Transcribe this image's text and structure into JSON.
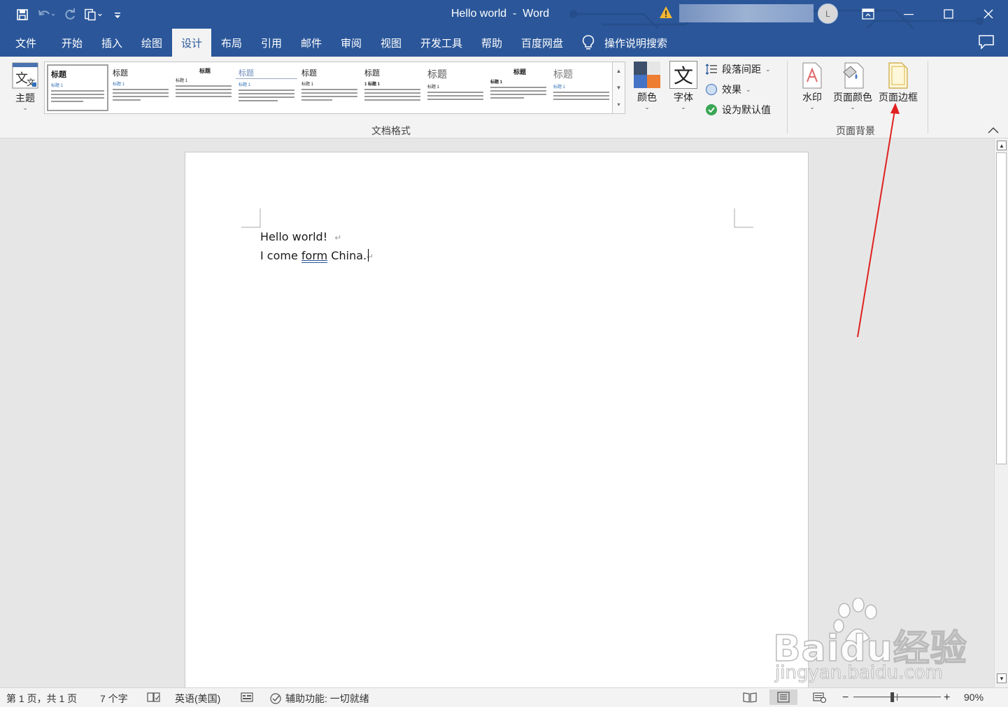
{
  "window": {
    "title": "Hello world  -  Word",
    "account_initial": "L"
  },
  "quick_access": {
    "save_icon": "save-icon",
    "undo_icon": "undo-icon",
    "redo_icon": "redo-icon",
    "format_painter_icon": "paste-icon",
    "customize_icon": "customize-icon"
  },
  "tabs": [
    {
      "label": "文件",
      "active": false
    },
    {
      "label": "开始",
      "active": false
    },
    {
      "label": "插入",
      "active": false
    },
    {
      "label": "绘图",
      "active": false
    },
    {
      "label": "设计",
      "active": true
    },
    {
      "label": "布局",
      "active": false
    },
    {
      "label": "引用",
      "active": false
    },
    {
      "label": "邮件",
      "active": false
    },
    {
      "label": "审阅",
      "active": false
    },
    {
      "label": "视图",
      "active": false
    },
    {
      "label": "开发工具",
      "active": false
    },
    {
      "label": "帮助",
      "active": false
    },
    {
      "label": "百度网盘",
      "active": false
    }
  ],
  "tell_me": "操作说明搜索",
  "ribbon": {
    "themes_label": "主题",
    "theme_icon_char": "文",
    "gallery": {
      "items": [
        {
          "heading": "标题",
          "subheading": "标题 1"
        },
        {
          "heading": "标题",
          "subheading": "标题 1"
        },
        {
          "heading": "标题",
          "subheading": "标题 1"
        },
        {
          "heading": "标题",
          "subheading": "标题 1"
        },
        {
          "heading": "标题",
          "subheading": "标题 1"
        },
        {
          "heading": "标题",
          "subheading": "1  标题 1"
        },
        {
          "heading": "标题",
          "subheading": "标题 1"
        },
        {
          "heading": "标题",
          "subheading": "标题 1"
        },
        {
          "heading": "标题",
          "subheading": "标题 1"
        }
      ]
    },
    "colors_label": "颜色",
    "fonts_label": "字体",
    "fonts_icon_char": "文",
    "paragraph_spacing_label": "段落间距",
    "effects_label": "效果",
    "set_default_label": "设为默认值",
    "doc_format_group_label": "文档格式",
    "watermark_label": "水印",
    "page_color_label": "页面颜色",
    "page_borders_label": "页面边框",
    "page_background_group_label": "页面背景"
  },
  "document": {
    "line1": "Hello world!",
    "line2_pre": "I come ",
    "line2_err": "form",
    "line2_post": " China.",
    "paragraph_mark": "↵"
  },
  "status": {
    "page": "第 1 页，共 1 页",
    "words": "7 个字",
    "language": "英语(美国)",
    "accessibility": "辅助功能: 一切就绪",
    "zoom": "90%",
    "zoom_level": 0.9
  },
  "watermark": {
    "brand": "Baidu经验",
    "url": "jingyan.baidu.com"
  },
  "colors": {
    "brand_blue": "#2b579a",
    "annotation_red": "#e02020"
  }
}
